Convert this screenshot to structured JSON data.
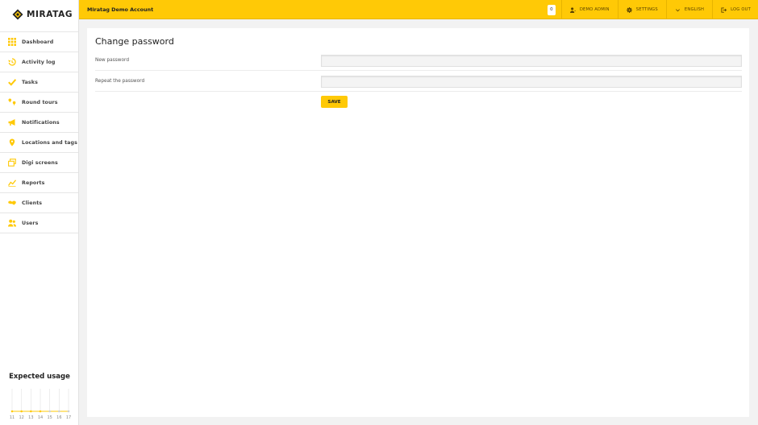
{
  "brand": {
    "name": "MIRATAG",
    "accent": "#ffc906"
  },
  "sidebar": {
    "items": [
      {
        "label": "Dashboard",
        "icon": "grid-icon"
      },
      {
        "label": "Activity log",
        "icon": "history-icon"
      },
      {
        "label": "Tasks",
        "icon": "checkmark-icon"
      },
      {
        "label": "Round tours",
        "icon": "route-pins-icon"
      },
      {
        "label": "Notifications",
        "icon": "megaphone-icon"
      },
      {
        "label": "Locations and tags",
        "icon": "map-pin-icon"
      },
      {
        "label": "Digi screens",
        "icon": "screens-icon"
      },
      {
        "label": "Reports",
        "icon": "trend-icon"
      },
      {
        "label": "Clients",
        "icon": "handshake-icon"
      },
      {
        "label": "Users",
        "icon": "users-icon"
      }
    ]
  },
  "usage": {
    "title": "Expected usage",
    "chart_data": {
      "type": "line",
      "categories": [
        "11",
        "12",
        "13",
        "14",
        "15",
        "16",
        "17"
      ],
      "series": [
        {
          "values": [
            0,
            0,
            0,
            0,
            0,
            0,
            0
          ]
        }
      ]
    }
  },
  "topbar": {
    "account_name": "Miratag Demo Account",
    "counter": "0",
    "user_label": "DEMO ADMIN",
    "settings_label": "SETTINGS",
    "language_label": "ENGLISH",
    "logout_label": "LOG OUT"
  },
  "main": {
    "title": "Change password",
    "fields": [
      {
        "label": "New password",
        "value": ""
      },
      {
        "label": "Repeat the password",
        "value": ""
      }
    ],
    "save_label": "SAVE"
  }
}
